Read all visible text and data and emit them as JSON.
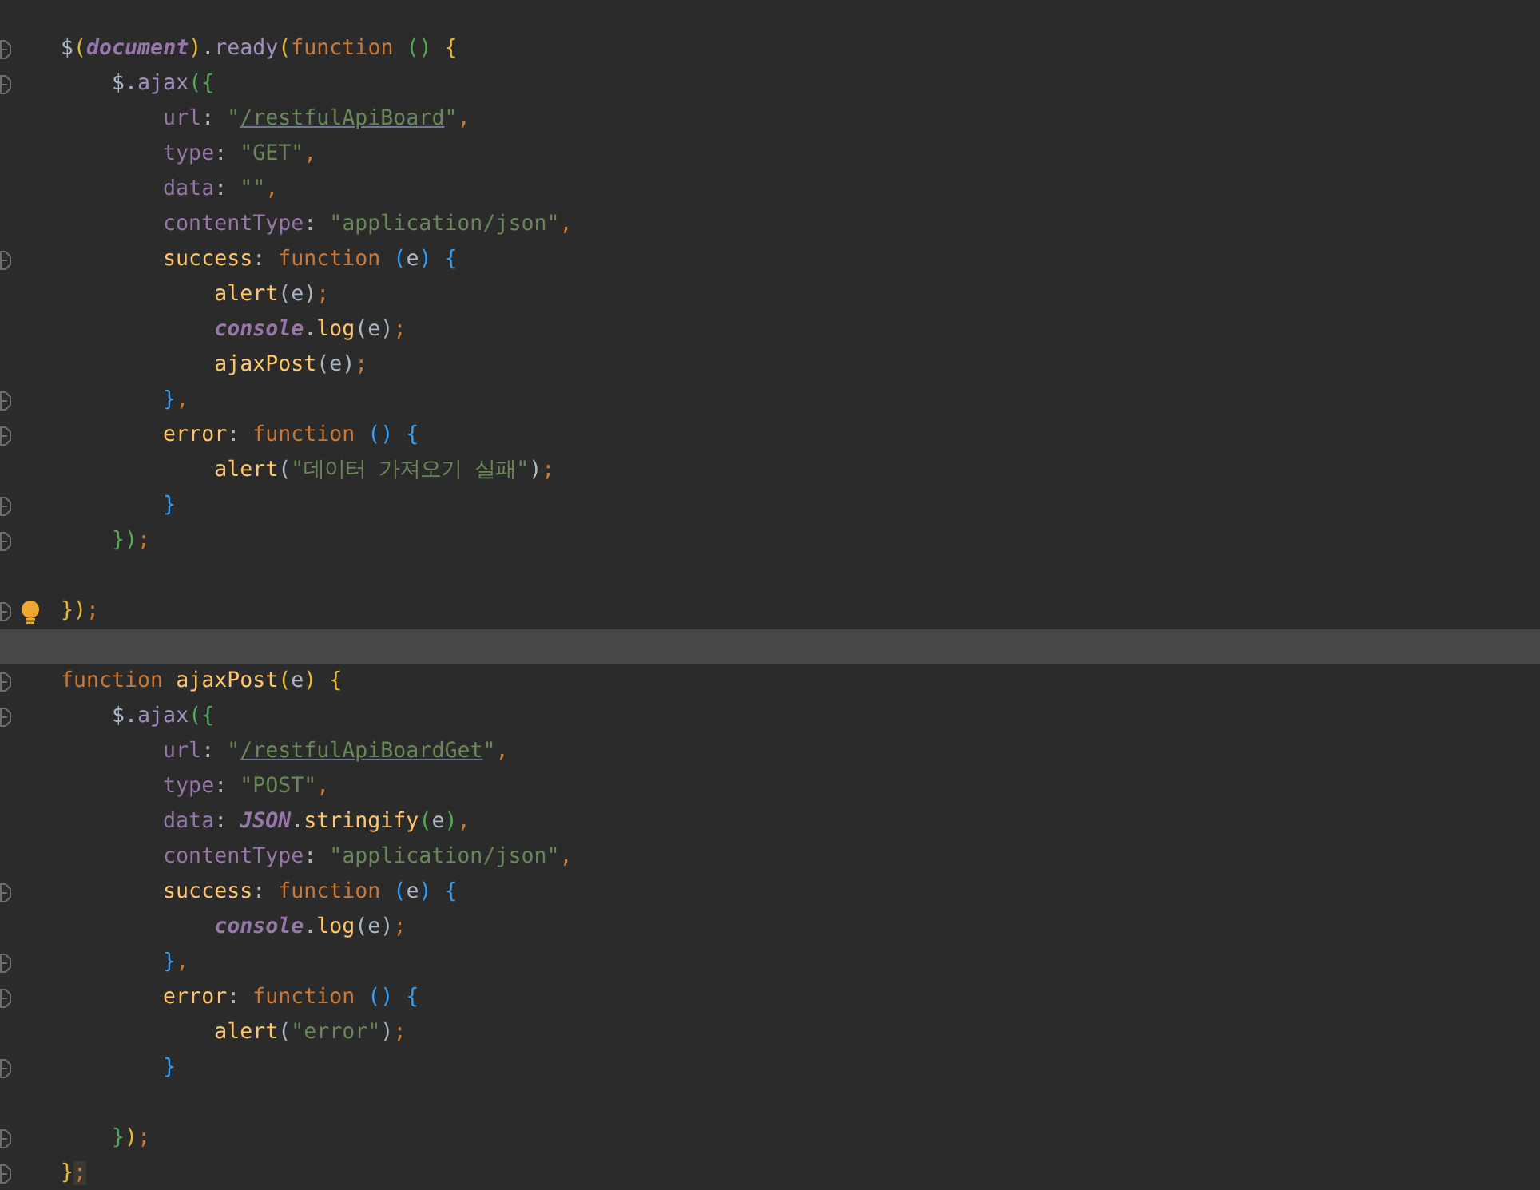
{
  "editor": {
    "lines": [
      {
        "fold": true,
        "bulb": false,
        "current": false,
        "tokens": [
          {
            "text": "$",
            "kind": "plain"
          },
          {
            "text": "(",
            "kind": "paren1"
          },
          {
            "text": "document",
            "kind": "global"
          },
          {
            "text": ")",
            "kind": "paren1"
          },
          {
            "text": ".",
            "kind": "plain"
          },
          {
            "text": "ready",
            "kind": "member"
          },
          {
            "text": "(",
            "kind": "paren1"
          },
          {
            "text": "function ",
            "kind": "keyword"
          },
          {
            "text": "() ",
            "kind": "paren2"
          },
          {
            "text": "{",
            "kind": "paren1"
          }
        ]
      },
      {
        "fold": true,
        "bulb": false,
        "current": false,
        "tokens": [
          {
            "text": "    $.",
            "kind": "plain"
          },
          {
            "text": "ajax",
            "kind": "member"
          },
          {
            "text": "({",
            "kind": "paren2"
          }
        ]
      },
      {
        "fold": false,
        "bulb": false,
        "current": false,
        "tokens": [
          {
            "text": "        url",
            "kind": "property"
          },
          {
            "text": ": ",
            "kind": "plain"
          },
          {
            "text": "\"",
            "kind": "string"
          },
          {
            "text": "/restfulApiBoard",
            "kind": "link"
          },
          {
            "text": "\"",
            "kind": "string"
          },
          {
            "text": ",",
            "kind": "separator"
          }
        ]
      },
      {
        "fold": false,
        "bulb": false,
        "current": false,
        "tokens": [
          {
            "text": "        type",
            "kind": "property"
          },
          {
            "text": ": ",
            "kind": "plain"
          },
          {
            "text": "\"GET\"",
            "kind": "string"
          },
          {
            "text": ",",
            "kind": "separator"
          }
        ]
      },
      {
        "fold": false,
        "bulb": false,
        "current": false,
        "tokens": [
          {
            "text": "        data",
            "kind": "property"
          },
          {
            "text": ": ",
            "kind": "plain"
          },
          {
            "text": "\"\"",
            "kind": "string"
          },
          {
            "text": ",",
            "kind": "separator"
          }
        ]
      },
      {
        "fold": false,
        "bulb": false,
        "current": false,
        "tokens": [
          {
            "text": "        contentType",
            "kind": "property"
          },
          {
            "text": ": ",
            "kind": "plain"
          },
          {
            "text": "\"application/json\"",
            "kind": "string"
          },
          {
            "text": ",",
            "kind": "separator"
          }
        ]
      },
      {
        "fold": true,
        "bulb": false,
        "current": false,
        "tokens": [
          {
            "text": "        success",
            "kind": "function"
          },
          {
            "text": ": ",
            "kind": "plain"
          },
          {
            "text": "function ",
            "kind": "keyword"
          },
          {
            "text": "(",
            "kind": "paren3"
          },
          {
            "text": "e",
            "kind": "plain"
          },
          {
            "text": ") {",
            "kind": "paren3"
          }
        ]
      },
      {
        "fold": false,
        "bulb": false,
        "current": false,
        "tokens": [
          {
            "text": "            alert",
            "kind": "function"
          },
          {
            "text": "(e)",
            "kind": "plain"
          },
          {
            "text": ";",
            "kind": "separator"
          }
        ]
      },
      {
        "fold": false,
        "bulb": false,
        "current": false,
        "tokens": [
          {
            "text": "            console",
            "kind": "global"
          },
          {
            "text": ".",
            "kind": "plain"
          },
          {
            "text": "log",
            "kind": "function"
          },
          {
            "text": "(e)",
            "kind": "plain"
          },
          {
            "text": ";",
            "kind": "separator"
          }
        ]
      },
      {
        "fold": false,
        "bulb": false,
        "current": false,
        "tokens": [
          {
            "text": "            ajaxPost",
            "kind": "function"
          },
          {
            "text": "(e)",
            "kind": "plain"
          },
          {
            "text": ";",
            "kind": "separator"
          }
        ]
      },
      {
        "fold": true,
        "bulb": false,
        "current": false,
        "tokens": [
          {
            "text": "        }",
            "kind": "paren3"
          },
          {
            "text": ",",
            "kind": "separator"
          }
        ]
      },
      {
        "fold": true,
        "bulb": false,
        "current": false,
        "tokens": [
          {
            "text": "        error",
            "kind": "function"
          },
          {
            "text": ": ",
            "kind": "plain"
          },
          {
            "text": "function ",
            "kind": "keyword"
          },
          {
            "text": "() {",
            "kind": "paren3"
          }
        ]
      },
      {
        "fold": false,
        "bulb": false,
        "current": false,
        "tokens": [
          {
            "text": "            alert",
            "kind": "function"
          },
          {
            "text": "(",
            "kind": "plain"
          },
          {
            "text": "\"데이터 가져오기 실패\"",
            "kind": "string"
          },
          {
            "text": ")",
            "kind": "plain"
          },
          {
            "text": ";",
            "kind": "separator"
          }
        ]
      },
      {
        "fold": true,
        "bulb": false,
        "current": false,
        "tokens": [
          {
            "text": "        }",
            "kind": "paren3"
          }
        ]
      },
      {
        "fold": true,
        "bulb": false,
        "current": false,
        "tokens": [
          {
            "text": "    })",
            "kind": "paren2"
          },
          {
            "text": ";",
            "kind": "separator"
          }
        ]
      },
      {
        "fold": false,
        "bulb": false,
        "current": false
      },
      {
        "fold": true,
        "bulb": true,
        "current": false,
        "tokens": [
          {
            "text": "})",
            "kind": "paren1"
          },
          {
            "text": ";",
            "kind": "separator"
          }
        ]
      },
      {
        "fold": false,
        "bulb": false,
        "current": true
      },
      {
        "fold": true,
        "bulb": false,
        "current": false,
        "tokens": [
          {
            "text": "function ",
            "kind": "keyword"
          },
          {
            "text": "ajaxPost",
            "kind": "function"
          },
          {
            "text": "(",
            "kind": "paren1"
          },
          {
            "text": "e",
            "kind": "plain"
          },
          {
            "text": ") {",
            "kind": "paren1"
          }
        ]
      },
      {
        "fold": true,
        "bulb": false,
        "current": false,
        "tokens": [
          {
            "text": "    $.",
            "kind": "plain"
          },
          {
            "text": "ajax",
            "kind": "member"
          },
          {
            "text": "({",
            "kind": "paren2"
          }
        ]
      },
      {
        "fold": false,
        "bulb": false,
        "current": false,
        "tokens": [
          {
            "text": "        url",
            "kind": "property"
          },
          {
            "text": ": ",
            "kind": "plain"
          },
          {
            "text": "\"",
            "kind": "string"
          },
          {
            "text": "/restfulApiBoardGet",
            "kind": "link"
          },
          {
            "text": "\"",
            "kind": "string"
          },
          {
            "text": ",",
            "kind": "separator"
          }
        ]
      },
      {
        "fold": false,
        "bulb": false,
        "current": false,
        "tokens": [
          {
            "text": "        type",
            "kind": "property"
          },
          {
            "text": ": ",
            "kind": "plain"
          },
          {
            "text": "\"POST\"",
            "kind": "string"
          },
          {
            "text": ",",
            "kind": "separator"
          }
        ]
      },
      {
        "fold": false,
        "bulb": false,
        "current": false,
        "tokens": [
          {
            "text": "        data",
            "kind": "property"
          },
          {
            "text": ": ",
            "kind": "plain"
          },
          {
            "text": "JSON",
            "kind": "global"
          },
          {
            "text": ".",
            "kind": "plain"
          },
          {
            "text": "stringify",
            "kind": "function"
          },
          {
            "text": "(",
            "kind": "paren2"
          },
          {
            "text": "e",
            "kind": "plain"
          },
          {
            "text": ")",
            "kind": "paren2"
          },
          {
            "text": ",",
            "kind": "separator"
          }
        ]
      },
      {
        "fold": false,
        "bulb": false,
        "current": false,
        "tokens": [
          {
            "text": "        contentType",
            "kind": "property"
          },
          {
            "text": ": ",
            "kind": "plain"
          },
          {
            "text": "\"application/json\"",
            "kind": "string"
          },
          {
            "text": ",",
            "kind": "separator"
          }
        ]
      },
      {
        "fold": true,
        "bulb": false,
        "current": false,
        "tokens": [
          {
            "text": "        success",
            "kind": "function"
          },
          {
            "text": ": ",
            "kind": "plain"
          },
          {
            "text": "function ",
            "kind": "keyword"
          },
          {
            "text": "(",
            "kind": "paren3"
          },
          {
            "text": "e",
            "kind": "plain"
          },
          {
            "text": ") {",
            "kind": "paren3"
          }
        ]
      },
      {
        "fold": false,
        "bulb": false,
        "current": false,
        "tokens": [
          {
            "text": "            console",
            "kind": "global"
          },
          {
            "text": ".",
            "kind": "plain"
          },
          {
            "text": "log",
            "kind": "function"
          },
          {
            "text": "(e)",
            "kind": "plain"
          },
          {
            "text": ";",
            "kind": "separator"
          }
        ]
      },
      {
        "fold": true,
        "bulb": false,
        "current": false,
        "tokens": [
          {
            "text": "        }",
            "kind": "paren3"
          },
          {
            "text": ",",
            "kind": "separator"
          }
        ]
      },
      {
        "fold": true,
        "bulb": false,
        "current": false,
        "tokens": [
          {
            "text": "        error",
            "kind": "function"
          },
          {
            "text": ": ",
            "kind": "plain"
          },
          {
            "text": "function ",
            "kind": "keyword"
          },
          {
            "text": "() {",
            "kind": "paren3"
          }
        ]
      },
      {
        "fold": false,
        "bulb": false,
        "current": false,
        "tokens": [
          {
            "text": "            alert",
            "kind": "function"
          },
          {
            "text": "(",
            "kind": "plain"
          },
          {
            "text": "\"error\"",
            "kind": "string"
          },
          {
            "text": ")",
            "kind": "plain"
          },
          {
            "text": ";",
            "kind": "separator"
          }
        ]
      },
      {
        "fold": true,
        "bulb": false,
        "current": false,
        "tokens": [
          {
            "text": "        }",
            "kind": "paren3"
          }
        ]
      },
      {
        "fold": false,
        "bulb": false,
        "current": false
      },
      {
        "fold": true,
        "bulb": false,
        "current": false,
        "tokens": [
          {
            "text": "    }",
            "kind": "paren2"
          },
          {
            "text": ")",
            "kind": "paren1"
          },
          {
            "text": ";",
            "kind": "separator"
          }
        ]
      },
      {
        "fold": true,
        "bulb": false,
        "current": false,
        "tokens": [
          {
            "text": "}",
            "kind": "paren1"
          },
          {
            "text": ";",
            "kind": "matched"
          }
        ]
      }
    ]
  }
}
